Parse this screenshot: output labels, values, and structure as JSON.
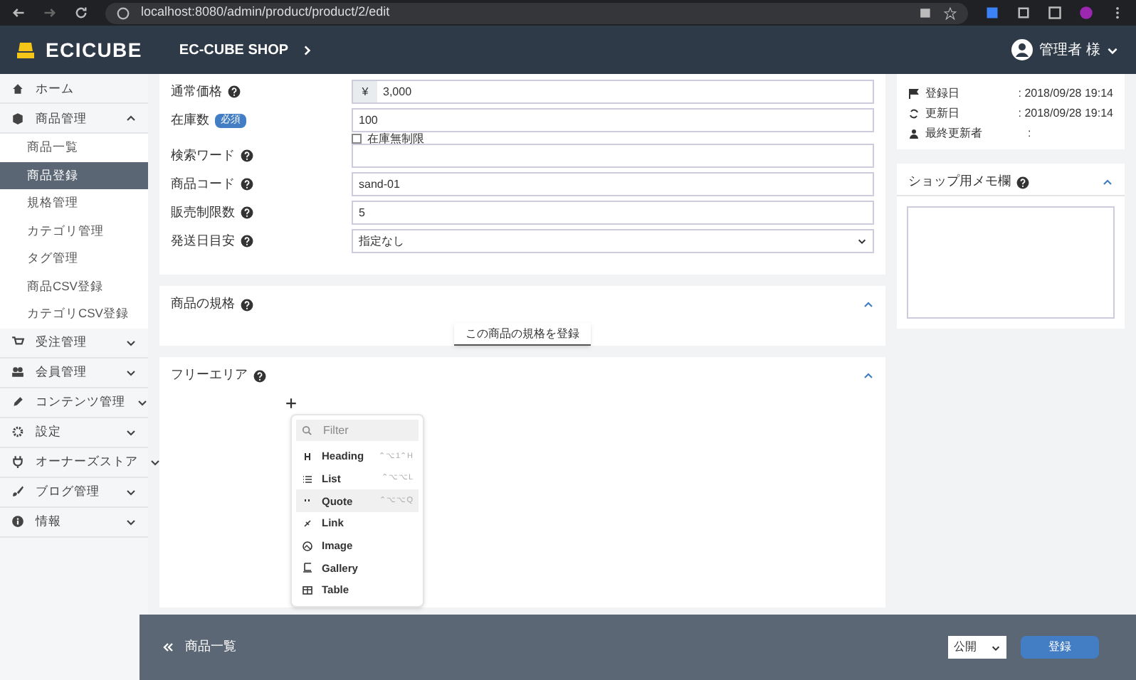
{
  "browser": {
    "url": "localhost:8080/admin/product/product/2/edit"
  },
  "header": {
    "logo": "ECICUBE",
    "shop": "EC-CUBE SHOP",
    "user": "管理者 様"
  },
  "sidebar": {
    "items": [
      {
        "label": "ホーム"
      },
      {
        "label": "商品管理",
        "expanded": true,
        "children": [
          {
            "label": "商品一覧",
            "selected": false
          },
          {
            "label": "商品登録",
            "selected": true
          },
          {
            "label": "規格管理",
            "selected": false
          },
          {
            "label": "カテゴリ管理",
            "selected": false
          },
          {
            "label": "タグ管理",
            "selected": false
          },
          {
            "label": "商品CSV登録",
            "selected": false
          },
          {
            "label": "カテゴリCSV登録",
            "selected": false
          }
        ]
      },
      {
        "label": "受注管理",
        "expanded": false
      },
      {
        "label": "会員管理",
        "expanded": false
      },
      {
        "label": "コンテンツ管理",
        "expanded": false
      },
      {
        "label": "設定",
        "expanded": false
      },
      {
        "label": "オーナーズストア",
        "expanded": false
      },
      {
        "label": "ブログ管理",
        "expanded": false
      },
      {
        "label": "情報",
        "expanded": false
      }
    ]
  },
  "form": {
    "rows": [
      {
        "kind": "price",
        "label": "通常価格",
        "help": true,
        "prefix": "¥",
        "value": "3,000"
      },
      {
        "kind": "stock",
        "label": "在庫数",
        "badge": "必須",
        "value": "100",
        "checkbox": {
          "label": "在庫無制限",
          "checked": false
        }
      },
      {
        "kind": "text",
        "label": "検索ワード",
        "help": true,
        "value": ""
      },
      {
        "kind": "text",
        "label": "商品コード",
        "help": true,
        "value": "sand-01"
      },
      {
        "kind": "text",
        "label": "販売制限数",
        "help": true,
        "value": "5"
      },
      {
        "kind": "select",
        "label": "発送日目安",
        "help": true,
        "value": "指定なし"
      }
    ]
  },
  "class_card": {
    "title": "商品の規格",
    "expanded": true,
    "button": "この商品の規格を登録"
  },
  "free_area": {
    "title": "フリーエリア",
    "expanded": true,
    "inserter": {
      "search": {
        "placeholder": "Filter"
      },
      "items": [
        {
          "label": "Heading",
          "shortcut": "⌃⌥1⌃H",
          "selected": false
        },
        {
          "label": "List",
          "shortcut": "⌃⌥⌥L",
          "selected": false
        },
        {
          "label": "Quote",
          "shortcut": "⌃⌥⌥Q",
          "selected": true
        },
        {
          "label": "Link",
          "selected": false
        },
        {
          "label": "Image",
          "selected": false
        },
        {
          "label": "Gallery",
          "selected": false
        },
        {
          "label": "Table",
          "selected": false
        }
      ]
    }
  },
  "info_card": {
    "rows": [
      {
        "label": "登録日",
        "value": ": 2018/09/28 19:14"
      },
      {
        "label": "更新日",
        "value": ": 2018/09/28 19:14"
      },
      {
        "label": "最終更新者",
        "value": ":"
      }
    ]
  },
  "memo_card": {
    "title": "ショップ用メモ欄",
    "expanded": true
  },
  "footer": {
    "back": "商品一覧",
    "status": "公開",
    "submit": "登録"
  }
}
